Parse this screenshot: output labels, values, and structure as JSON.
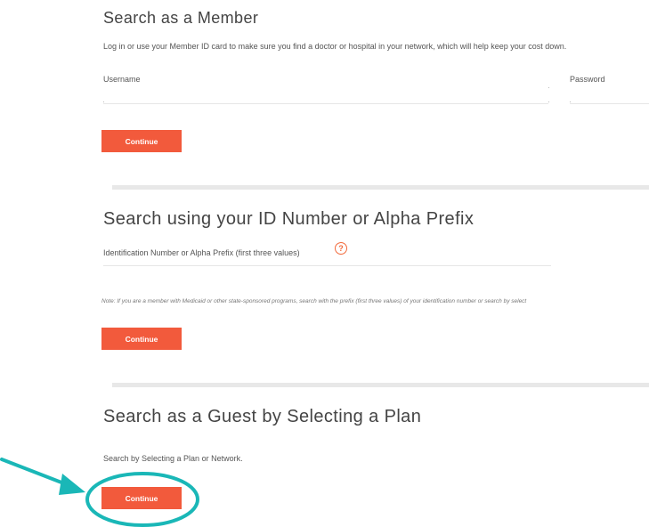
{
  "member_section": {
    "title": "Search as a Member",
    "description": "Log in or use your Member ID card to make sure you find a doctor or hospital in your network, which will help keep your cost down.",
    "username_label": "Username",
    "password_label": "Password",
    "username_value": "",
    "password_value": "",
    "continue_label": "Continue"
  },
  "id_section": {
    "title": "Search using your ID Number or Alpha Prefix",
    "field_label": "Identification Number or Alpha Prefix (first three values)",
    "field_value": "",
    "help_glyph": "?",
    "note": "Note: If you are a member with Medicaid or other state-sponsored programs, search with the prefix (first three values) of your identification number or search by select",
    "continue_label": "Continue"
  },
  "guest_section": {
    "title": "Search as a Guest by Selecting a Plan",
    "description": "Search by Selecting a Plan or Network.",
    "continue_label": "Continue"
  },
  "colors": {
    "button": "#f25a3c",
    "help_icon": "#f26a3c",
    "annotation": "#1ab7b7",
    "divider": "#e8e8e8"
  },
  "annotation": {
    "icons": [
      "arrow-icon",
      "highlight-circle-icon"
    ]
  }
}
